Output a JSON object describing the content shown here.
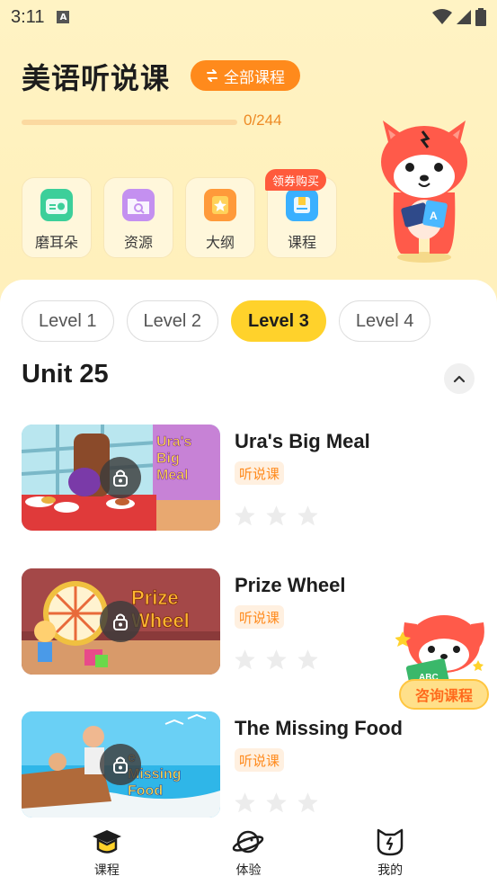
{
  "status_bar": {
    "time": "3:11",
    "notification_letter": "A"
  },
  "header": {
    "title": "美语听说课",
    "all_courses_label": "全部课程",
    "progress": {
      "completed": 0,
      "total": 244,
      "text": "0/244"
    }
  },
  "quick_actions": [
    {
      "label": "磨耳朵",
      "icon": "radio-icon"
    },
    {
      "label": "资源",
      "icon": "folder-search-icon"
    },
    {
      "label": "大纲",
      "icon": "outline-star-icon"
    },
    {
      "label": "课程",
      "icon": "book-icon",
      "badge": "领券购买"
    }
  ],
  "levels": [
    {
      "label": "Level 1",
      "active": false
    },
    {
      "label": "Level 2",
      "active": false
    },
    {
      "label": "Level 3",
      "active": true
    },
    {
      "label": "Level 4",
      "active": false
    }
  ],
  "unit": {
    "title": "Unit 25"
  },
  "lessons": [
    {
      "title": "Ura's Big Meal",
      "tag": "听说课",
      "stars": 0,
      "locked": true,
      "thumb_text": "Ura's Big Meal"
    },
    {
      "title": "Prize Wheel",
      "tag": "听说课",
      "stars": 0,
      "locked": true,
      "thumb_text": "Prize Wheel"
    },
    {
      "title": "The Missing Food",
      "tag": "听说课",
      "stars": 0,
      "locked": true,
      "thumb_text": "e Missing Food"
    }
  ],
  "consult": {
    "label": "咨询课程"
  },
  "bottom_nav": [
    {
      "label": "课程",
      "icon": "graduation-cap-icon",
      "active": true
    },
    {
      "label": "体验",
      "icon": "planet-icon",
      "active": false
    },
    {
      "label": "我的",
      "icon": "cat-face-icon",
      "active": false
    }
  ],
  "colors": {
    "accent": "#ff8a1c",
    "level_active": "#ffd22b",
    "header_bg": "#fff2c2"
  }
}
